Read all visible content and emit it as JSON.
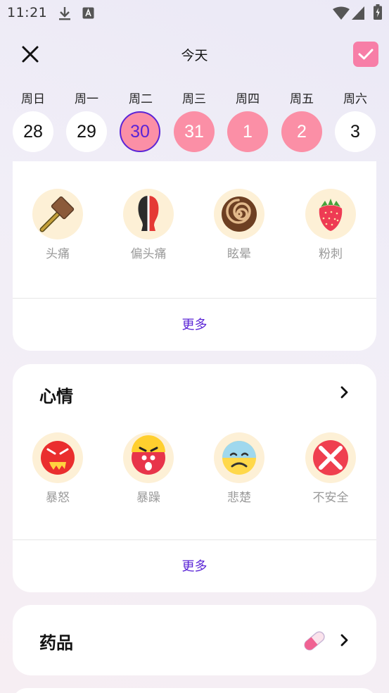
{
  "status_bar": {
    "time": "11:21",
    "icons": [
      "download-icon",
      "a-box-icon",
      "wifi-icon",
      "signal-icon",
      "battery-icon"
    ]
  },
  "header": {
    "title": "今天",
    "close_icon": "close-icon",
    "confirm_icon": "check-icon",
    "accent_color": "#f77ea7"
  },
  "calendar": {
    "weekdays": [
      "周日",
      "周一",
      "周二",
      "周三",
      "周四",
      "周五",
      "周六"
    ],
    "dates": [
      "28",
      "29",
      "30",
      "31",
      "1",
      "2",
      "3"
    ],
    "today_color": "#5b25d6",
    "period_color": "#fb8fa6"
  },
  "symptoms": {
    "items": [
      {
        "label": "头痛",
        "icon": "hammer-icon"
      },
      {
        "label": "偏头痛",
        "icon": "half-head-icon"
      },
      {
        "label": "眩晕",
        "icon": "spiral-icon"
      },
      {
        "label": "粉刺",
        "icon": "strawberry-icon"
      }
    ],
    "more_label": "更多"
  },
  "mood": {
    "title": "心情",
    "items": [
      {
        "label": "暴怒",
        "icon": "rage-face-icon"
      },
      {
        "label": "暴躁",
        "icon": "irritable-face-icon"
      },
      {
        "label": "悲楚",
        "icon": "sad-face-icon"
      },
      {
        "label": "不安全",
        "icon": "cross-icon"
      }
    ],
    "more_label": "更多"
  },
  "medicine": {
    "title": "药品",
    "icon": "pill-icon"
  }
}
